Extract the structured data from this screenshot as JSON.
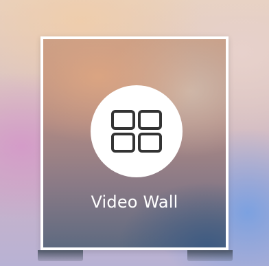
{
  "tile": {
    "title": "Video Wall",
    "icon": "video-wall-grid-icon"
  },
  "colors": {
    "frame_border": "#ffffff",
    "icon_circle": "#ffffff",
    "icon_stroke": "#333333",
    "label_text": "#ffffff"
  }
}
